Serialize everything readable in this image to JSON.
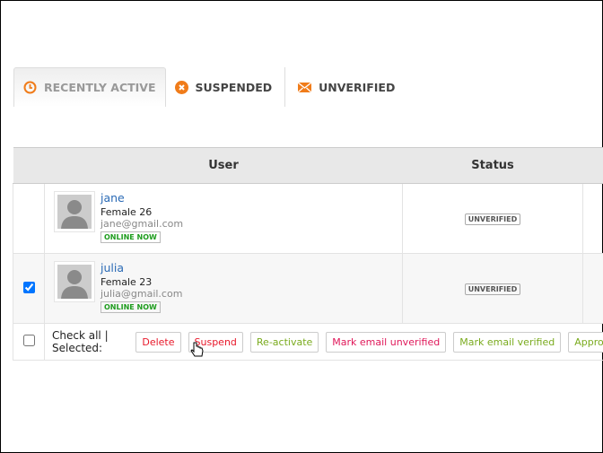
{
  "tabs": [
    {
      "label": "RECENTLY ACTIVE",
      "icon": "clock-icon",
      "active": true
    },
    {
      "label": "SUSPENDED",
      "icon": "x-circle-icon",
      "active": false
    },
    {
      "label": "UNVERIFIED",
      "icon": "envelope-icon",
      "active": false
    }
  ],
  "table": {
    "headers": {
      "user": "User",
      "status": "Status"
    },
    "rows": [
      {
        "name": "jane",
        "gender_age": "Female 26",
        "email": "jane@gmail.com",
        "online": "ONLINE NOW",
        "status": "UNVERIFIED",
        "checked": false
      },
      {
        "name": "julia",
        "gender_age": "Female 23",
        "email": "julia@gmail.com",
        "online": "ONLINE NOW",
        "status": "UNVERIFIED",
        "checked": true
      }
    ]
  },
  "footer": {
    "label": "Check all | Selected:",
    "buttons": [
      "Delete",
      "Suspend",
      "Re-activate",
      "Mark email unverified",
      "Mark email verified",
      "Approve"
    ]
  },
  "colors": {
    "accent": "#f07c1a",
    "red": "#e8182a",
    "pink": "#e0185a",
    "green": "#7aab1e",
    "link": "#2a6ab5"
  }
}
